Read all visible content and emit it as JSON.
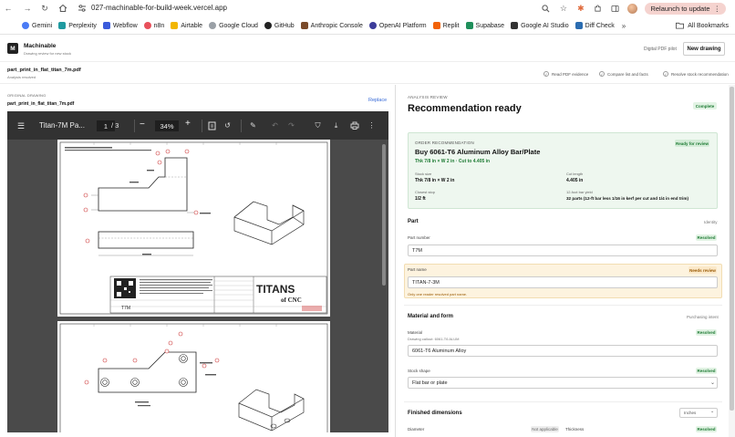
{
  "browser": {
    "url": "027-machinable-for-build-week.vercel.app",
    "relaunch_label": "Relaunch to update",
    "bookmarks": [
      {
        "label": "Gemini",
        "icon": "gemini-icon",
        "color": "#4a7bf5"
      },
      {
        "label": "Perplexity",
        "icon": "perplexity-icon",
        "color": "#1f9aa0"
      },
      {
        "label": "Webflow",
        "icon": "webflow-icon",
        "color": "#3b5bdb"
      },
      {
        "label": "n8n",
        "icon": "n8n-icon",
        "color": "#e8505b"
      },
      {
        "label": "Airtable",
        "icon": "airtable-icon",
        "color": "#f2b600"
      },
      {
        "label": "Google Cloud",
        "icon": "google-cloud-icon",
        "color": "#4285f4"
      },
      {
        "label": "GitHub",
        "icon": "github-icon",
        "color": "#222222"
      },
      {
        "label": "Anthropic Console",
        "icon": "anthropic-icon",
        "color": "#7a4a2a"
      },
      {
        "label": "OpenAI Platform",
        "icon": "openai-icon",
        "color": "#3c3c9a"
      },
      {
        "label": "Replit",
        "icon": "replit-icon",
        "color": "#f26207"
      },
      {
        "label": "Supabase",
        "icon": "supabase-icon",
        "color": "#1f8f5b"
      },
      {
        "label": "Google AI Studio",
        "icon": "google-ai-studio-icon",
        "color": "#333333"
      },
      {
        "label": "Diff Check",
        "icon": "diff-check-icon",
        "color": "#2b6cb0"
      }
    ],
    "more_label": "»",
    "all_bookmarks_label": "All Bookmarks"
  },
  "app": {
    "logo_letter": "M",
    "name": "Machinable",
    "subtitle": "Drawing review for new stock",
    "mode_label": "Digital PDF pilot",
    "new_drawing_label": "New drawing",
    "file_name": "part_print_in_flat_titan_7m.pdf",
    "file_status": "Analysis resolved",
    "steps": [
      "Read PDF evidence",
      "Compare list and facts",
      "Resolve stock recommendation"
    ]
  },
  "left": {
    "section_label": "ORIGINAL DRAWING",
    "file_name": "part_print_in_flat_titan_7m.pdf",
    "replace_label": "Replace",
    "viewer": {
      "doc_title": "Titan-7M Pa...",
      "page_current": "1",
      "page_total": "/ 3",
      "zoom": "34%",
      "drawing_logo": "TITANS",
      "drawing_logo_sub": "of CNC",
      "drawing_part": "T7M"
    }
  },
  "right": {
    "section_label": "ANALYSIS REVIEW",
    "title": "Recommendation ready",
    "status_badge": "Complete",
    "reco": {
      "label": "ORDER RECOMMENDATION",
      "badge": "Ready for review",
      "title": "Buy 6061-T6 Aluminum Alloy Bar/Plate",
      "subtitle": "Thk 7/8 in × W 2 in · Cut to 4.405 in",
      "stock_size_label": "Stock size",
      "stock_size": "Thk 7/8 in × W 2 in",
      "cut_length_label": "Cut length",
      "cut_length": "4.405 in",
      "closest_stop_label": "Closest stop",
      "closest_stop": "1/2 ft",
      "yield_label": "12-foot bar yield",
      "yield": "32 parts (12-ft bar less 1/16 in kerf per cut and 1/4 in end trim)"
    },
    "part": {
      "title": "Part",
      "tag": "Identity",
      "part_number_label": "Part number",
      "part_number_badge": "Resolved",
      "part_number": "T7M",
      "part_name_label": "Part name",
      "part_name_badge": "Needs review",
      "part_name": "TITAN-7-3M",
      "part_name_note": "Only one reader resolved part name."
    },
    "material": {
      "title": "Material and form",
      "tag": "Purchasing intent",
      "material_label": "Material",
      "material_badge": "Resolved",
      "material_callout": "Drawing callout: 6061-T6 ALUM",
      "material_value": "6061-T6 Aluminum Alloy",
      "stock_shape_label": "Stock shape",
      "stock_shape_badge": "Resolved",
      "stock_shape_value": "Flat bar or plate"
    },
    "dimensions": {
      "title": "Finished dimensions",
      "units": "Inches",
      "diameter_label": "Diameter",
      "diameter_badge": "Not applicable",
      "thickness_label": "Thickness",
      "thickness_badge": "Resolved"
    }
  }
}
